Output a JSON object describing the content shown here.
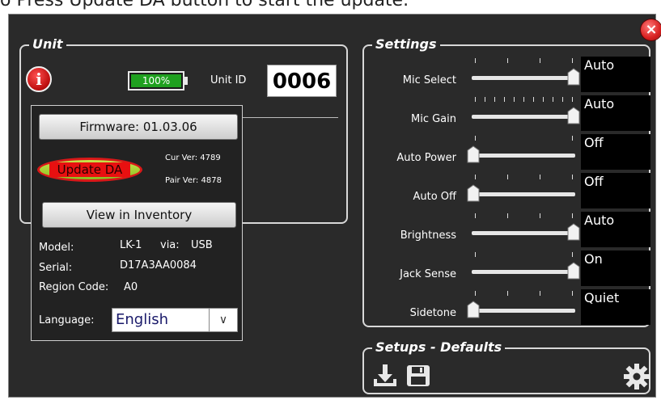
{
  "instruction": "o Press Update DA button to start the update.",
  "window": {
    "close_label": "×"
  },
  "unit": {
    "title": "Unit",
    "battery_label": "100%",
    "battery_level": 1.0,
    "unit_id_label": "Unit ID",
    "unit_id_value": "0006"
  },
  "popup": {
    "firmware_button": "Firmware: 01.03.06",
    "update_button": "Update DA",
    "cur_ver": "Cur Ver: 4789",
    "pair_ver": "Pair Ver: 4878",
    "inventory_button": "View in Inventory",
    "model_label": "Model:",
    "model_value": "LK-1",
    "via_label": "via:",
    "via_value": "USB",
    "serial_label": "Serial:",
    "serial_value": "D17A3AA0084",
    "region_label": "Region Code:",
    "region_value": "A0",
    "language_label": "Language:",
    "language_value": "English"
  },
  "settings": {
    "title": "Settings",
    "items": [
      {
        "label": "Mic Select",
        "value": "Auto",
        "level": 1.0,
        "ticks": 4
      },
      {
        "label": "Mic Gain",
        "value": "Auto",
        "level": 1.0,
        "ticks": 11
      },
      {
        "label": "Auto Power",
        "value": "Off",
        "level": 0.0,
        "ticks": 2
      },
      {
        "label": "Auto Off",
        "value": "Off",
        "level": 0.0,
        "ticks": 4
      },
      {
        "label": "Brightness",
        "value": "Auto",
        "level": 1.0,
        "ticks": 4
      },
      {
        "label": "Jack Sense",
        "value": "On",
        "level": 1.0,
        "ticks": 2
      },
      {
        "label": "Sidetone",
        "value": "Quiet",
        "level": 0.0,
        "ticks": 4
      }
    ]
  },
  "setups": {
    "title": "Setups - Defaults",
    "icons": [
      "download-icon",
      "save-icon",
      "gear-icon"
    ]
  }
}
